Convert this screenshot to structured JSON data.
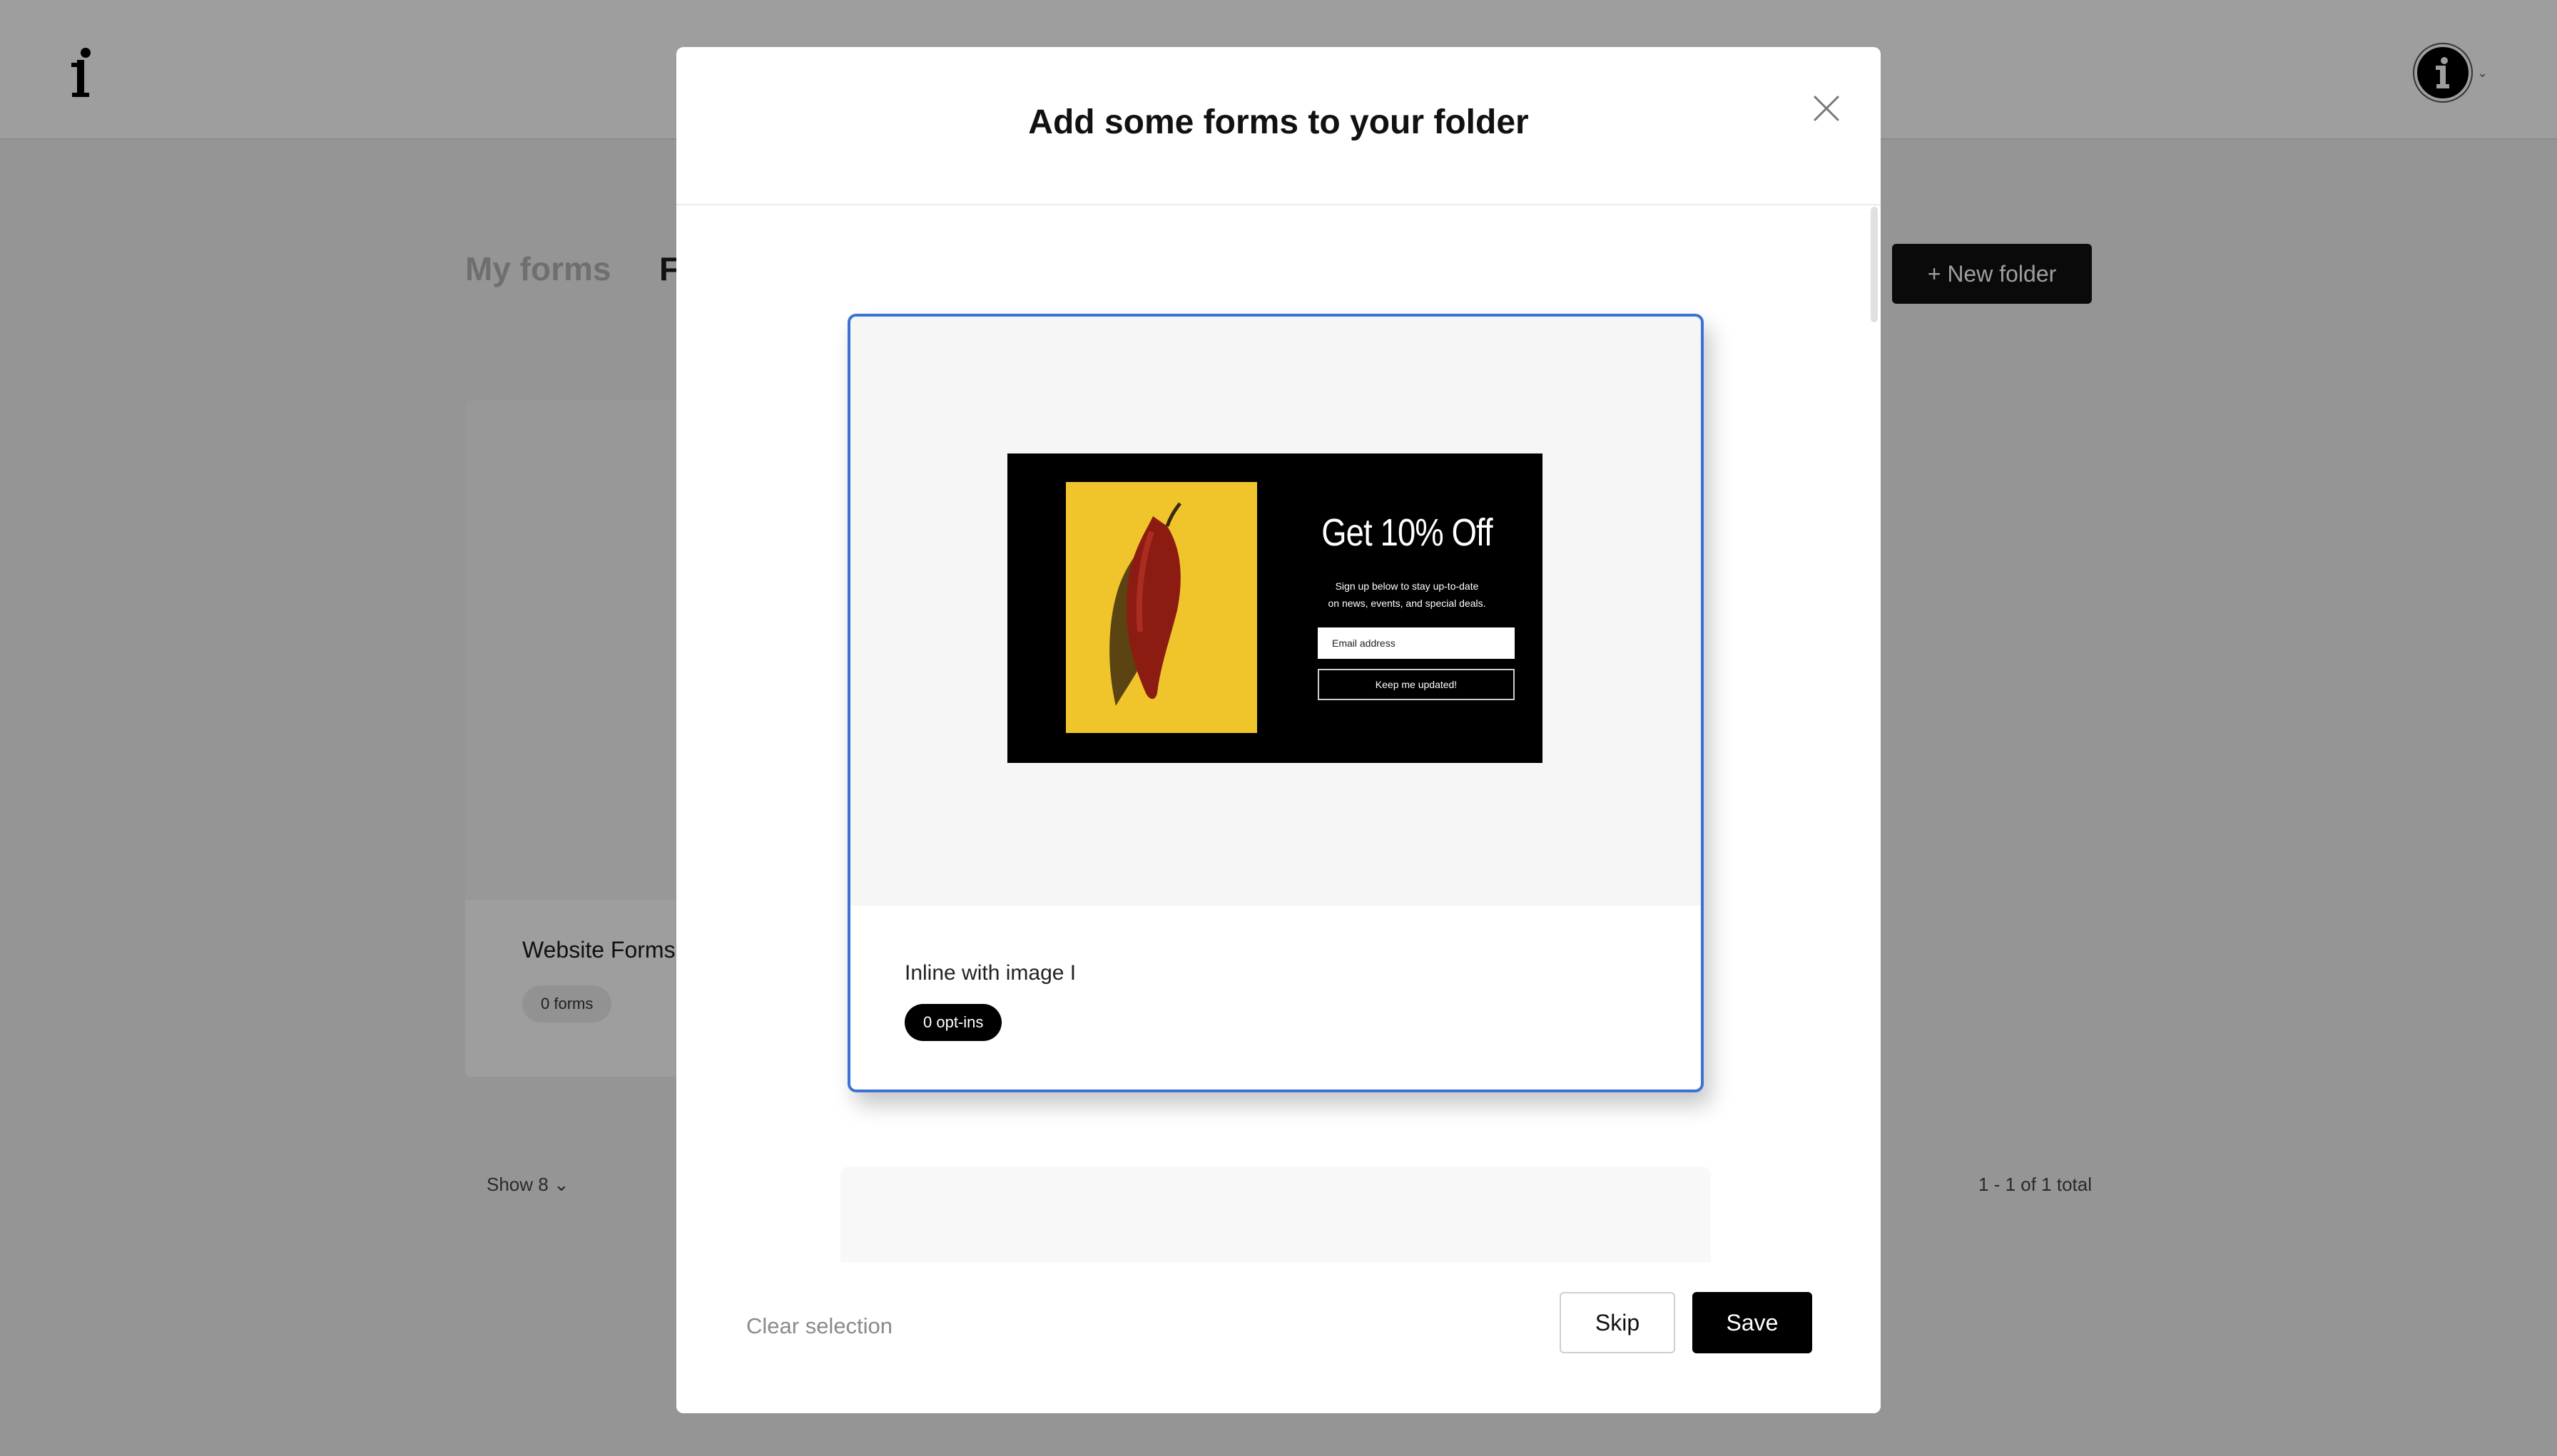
{
  "background": {
    "tabs": [
      {
        "label": "My forms"
      },
      {
        "label": "F"
      }
    ],
    "new_folder_label": "+ New folder",
    "folder": {
      "name": "Website Forms",
      "count": "0 forms"
    },
    "show_label": "Show 8 ⌄",
    "pagination": "1 - 1 of 1 total"
  },
  "modal": {
    "title": "Add some forms to your folder",
    "forms": [
      {
        "name": "Inline with image I",
        "optins": "0 opt-ins",
        "selected": true,
        "preview": {
          "heading": "Get 10% Off",
          "subtext_line1": "Sign up below to stay up-to-date",
          "subtext_line2": "on news, events, and special deals.",
          "email_placeholder": "Email address",
          "button_label": "Keep me updated!"
        }
      }
    ],
    "clear_selection_label": "Clear selection",
    "skip_label": "Skip",
    "save_label": "Save"
  },
  "colors": {
    "selection_border": "#3b73d4",
    "primary_button": "#000000",
    "preview_image_bg": "#f0c52c"
  },
  "icons": [
    "app-logo-icon",
    "avatar-icon",
    "chevron-down-icon",
    "close-icon"
  ]
}
